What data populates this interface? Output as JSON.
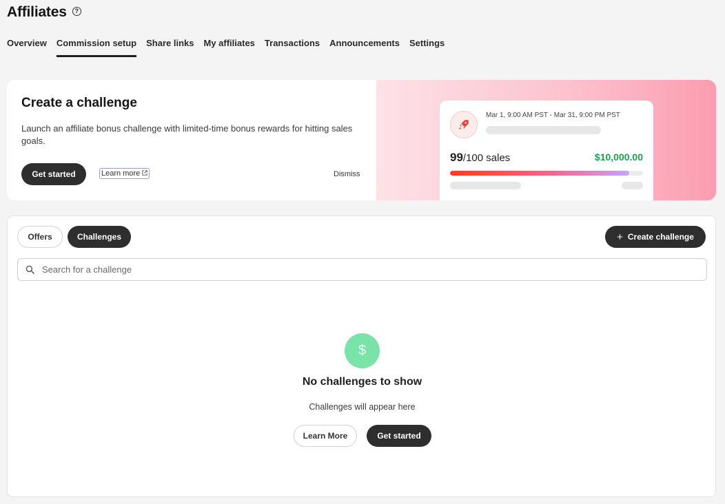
{
  "page": {
    "title": "Affiliates"
  },
  "icons": {
    "help": "help-circle-icon",
    "external": "external-link-icon",
    "rocket": "rocket-icon",
    "search": "search-icon",
    "plus": "plus-icon",
    "dollar": "dollar-icon"
  },
  "colors": {
    "accent_green": "#16a34a",
    "empty_icon_bg": "#79e3a8",
    "dark_button": "#2e2e2e"
  },
  "tabs": [
    {
      "label": "Overview"
    },
    {
      "label": "Commission setup",
      "active": true
    },
    {
      "label": "Share links"
    },
    {
      "label": "My affiliates"
    },
    {
      "label": "Transactions"
    },
    {
      "label": "Announcements"
    },
    {
      "label": "Settings"
    }
  ],
  "promo": {
    "title": "Create a challenge",
    "description": "Launch an affiliate bonus challenge with limited-time bonus rewards for hitting sales goals.",
    "get_started": "Get started",
    "learn_more": "Learn more",
    "dismiss": "Dismiss",
    "preview": {
      "date_range": "Mar 1, 9:00 AM PST - Mar 31, 9:00 PM PST",
      "sales_count": "99",
      "sales_suffix": "/100 sales",
      "amount": "$10,000.00",
      "progress_fraction": 0.93
    }
  },
  "panel": {
    "filters": {
      "offers": "Offers",
      "challenges": "Challenges"
    },
    "create_label": "Create challenge",
    "search_placeholder": "Search for a challenge",
    "empty": {
      "icon_glyph": "$",
      "title": "No challenges to show",
      "subtitle": "Challenges will appear here",
      "learn_more": "Learn More",
      "get_started": "Get started"
    }
  }
}
